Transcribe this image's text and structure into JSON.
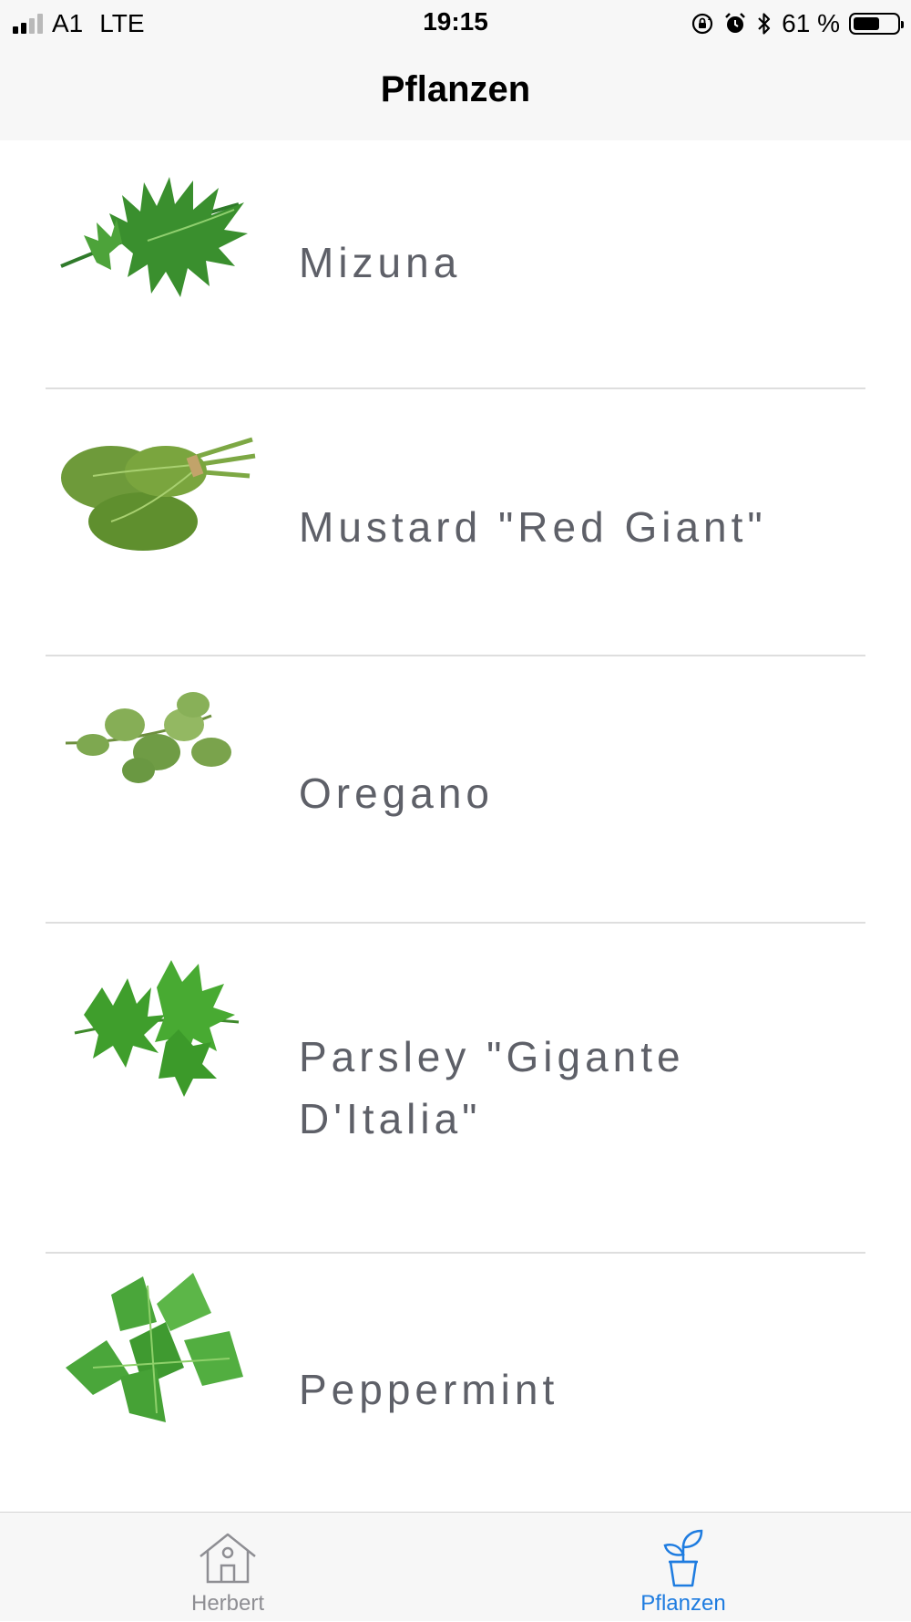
{
  "status_bar": {
    "carrier": "A1",
    "network": "LTE",
    "time": "19:15",
    "battery_percent_text": "61 %",
    "battery_level": 0.61,
    "signal_bars_filled": 2,
    "signal_bars_total": 4,
    "icons": [
      "orientation-lock-icon",
      "alarm-icon",
      "bluetooth-icon",
      "battery-icon"
    ]
  },
  "nav": {
    "title": "Pflanzen"
  },
  "plants": [
    {
      "name": "Mizuna",
      "image": "mizuna-plant-image"
    },
    {
      "name": "Mustard \"Red Giant\"",
      "image": "mustard-red-giant-plant-image"
    },
    {
      "name": "Oregano",
      "image": "oregano-plant-image"
    },
    {
      "name": "Parsley \"Gigante D'Italia\"",
      "image": "parsley-plant-image"
    },
    {
      "name": "Peppermint",
      "image": "peppermint-plant-image"
    }
  ],
  "tabs": [
    {
      "label": "Herbert",
      "icon": "house-icon",
      "active": false
    },
    {
      "label": "Pflanzen",
      "icon": "potted-plant-icon",
      "active": true
    }
  ],
  "colors": {
    "tab_active": "#1e7ce0",
    "tab_inactive": "#8e8e93",
    "plant_name_text": "#5e6068",
    "bar_background": "#f7f7f7"
  }
}
